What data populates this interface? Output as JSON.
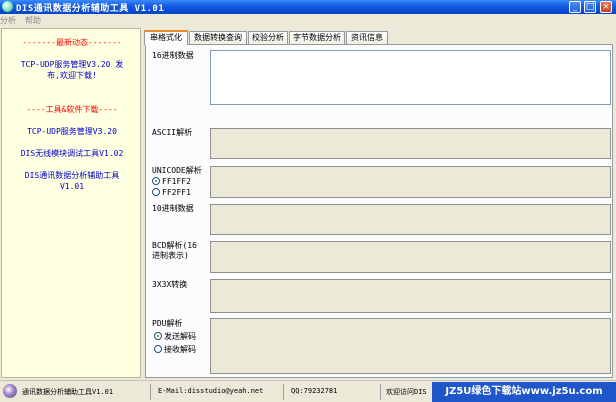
{
  "window": {
    "title": "DIS通讯数据分析辅助工具 V1.01"
  },
  "menu": [
    "分析",
    "帮助"
  ],
  "left_panel": {
    "news_header": "-------最新动态-------",
    "news_line1": "TCP-UDP服务管理V3.20 发",
    "news_line2": "布,欢迎下载!",
    "downloads_header": "----工具&软件下载----",
    "links": [
      "TCP-UDP服务管理V3.20",
      "DIS无线模块调试工具V1.02",
      "DIS通讯数据分析辅助工具",
      "V1.01"
    ]
  },
  "tabs": [
    "串格式化",
    "数据转换查询",
    "校验分析",
    "字节数据分析",
    "资讯信息"
  ],
  "fields": {
    "hex": "16进制数据",
    "ascii": "ASCII解析",
    "unicode": "UNICODE解析",
    "unicode_opt1": "FF1FF2",
    "unicode_opt2": "FF2FF1",
    "decimal": "10进制数据",
    "bcd_line1": "BCD解析(16",
    "bcd_line2": "进制表示)",
    "conv": "3X3X转换",
    "pdu": "PDU解析",
    "pdu_opt1": "发送解码",
    "pdu_opt2": "接收解码"
  },
  "statusbar": {
    "app": "通讯数据分析辅助工具V1.01",
    "email": "E-Mail:disstudio@yeah.net",
    "qq": "QQ:79232781",
    "visit": "欢迎访问DIS"
  },
  "watermark": "JZ5U绿色下载站www.jz5u.com"
}
